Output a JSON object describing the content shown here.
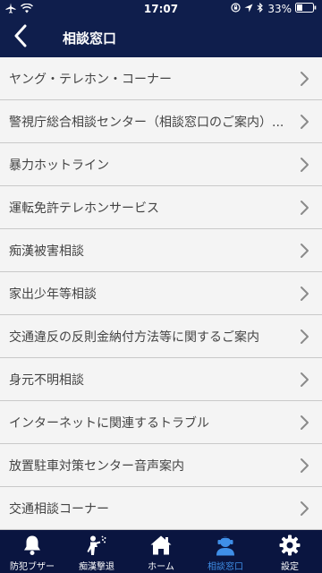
{
  "status_bar": {
    "time": "17:07",
    "battery": "33%"
  },
  "header": {
    "title": "相談窓口",
    "back_icon": "chevron-left-icon"
  },
  "list": {
    "items": [
      {
        "label": "ヤング・テレホン・コーナー"
      },
      {
        "label": "警視庁総合相談センター（相談窓口のご案内）..."
      },
      {
        "label": "暴力ホットライン"
      },
      {
        "label": "運転免許テレホンサービス"
      },
      {
        "label": "痴漢被害相談"
      },
      {
        "label": "家出少年等相談"
      },
      {
        "label": "交通違反の反則金納付方法等に関するご案内"
      },
      {
        "label": "身元不明相談"
      },
      {
        "label": "インターネットに関連するトラブル"
      },
      {
        "label": "放置駐車対策センター音声案内"
      },
      {
        "label": "交通相談コーナー"
      }
    ]
  },
  "tab_bar": {
    "tabs": [
      {
        "label": "防犯ブザー",
        "icon": "bell-icon"
      },
      {
        "label": "痴漢撃退",
        "icon": "spray-icon"
      },
      {
        "label": "ホーム",
        "icon": "home-icon"
      },
      {
        "label": "相談窓口",
        "icon": "person-icon",
        "active": true
      },
      {
        "label": "設定",
        "icon": "gear-icon"
      }
    ]
  },
  "colors": {
    "nav_background": "#0f1e4c",
    "tab_background": "#0a1540",
    "list_background": "#f4f4f4",
    "active_tab": "#3f8fe8",
    "divider": "#c9c9c9"
  }
}
